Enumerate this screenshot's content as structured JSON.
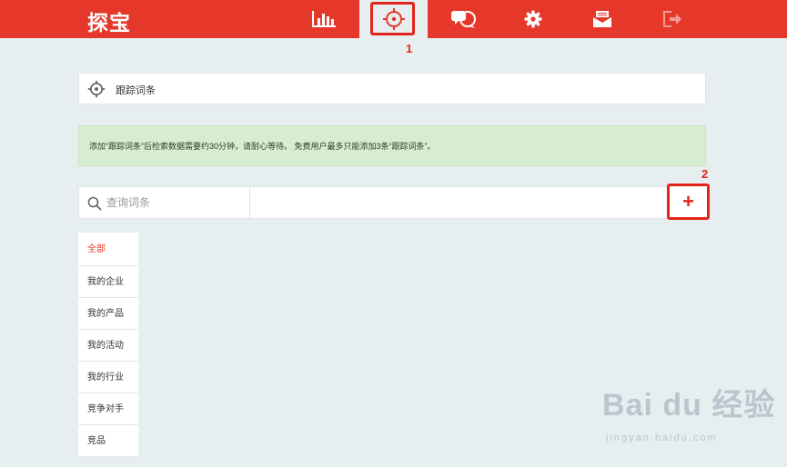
{
  "header": {
    "logo": "探宝",
    "nav": [
      {
        "id": "stats",
        "icon": "bar-chart-icon"
      },
      {
        "id": "track",
        "icon": "crosshair-icon",
        "active": true
      },
      {
        "id": "chat",
        "icon": "chat-bubbles-icon"
      },
      {
        "id": "settings",
        "icon": "gear-icon"
      },
      {
        "id": "inbox",
        "icon": "inbox-icon"
      },
      {
        "id": "logout",
        "icon": "logout-icon"
      }
    ]
  },
  "annotations": {
    "mark_1": "1",
    "mark_2": "2"
  },
  "panel": {
    "title": "跟踪词条",
    "icon": "crosshair-icon"
  },
  "notice": {
    "text": "添加“跟踪词条”后检索数据需要约30分钟，请耐心等待。 免费用户最多只能添加3条“跟踪词条”。"
  },
  "search": {
    "placeholder": "查询词条",
    "value": "",
    "add_label": "+"
  },
  "categories": [
    "全部",
    "我的企业",
    "我的产品",
    "我的活动",
    "我的行业",
    "竞争对手",
    "竞品"
  ],
  "watermark": {
    "main": "Bai du 经验",
    "sub": "jingyan.baidu.com"
  },
  "colors": {
    "brand": "#e5382b",
    "highlight": "#e3241b",
    "notice_bg": "#d7edcf",
    "page_bg": "#e7eef0"
  }
}
